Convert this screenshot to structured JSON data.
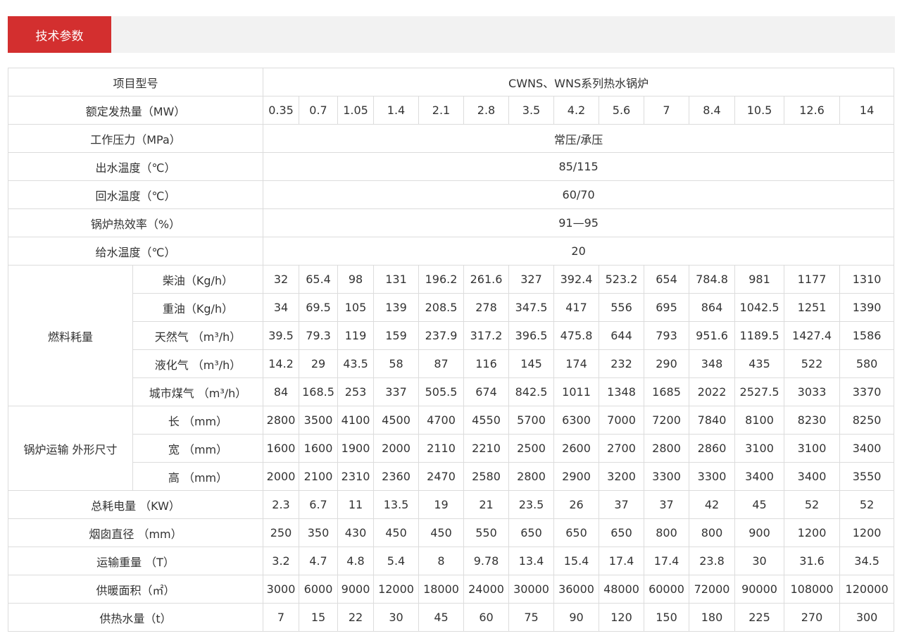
{
  "header": {
    "tab_label": "技术参数"
  },
  "table": {
    "model_label": "项目型号",
    "series_name": "CWNS、WNS系列热水锅炉",
    "capacity_label": "额定发热量（MW）",
    "capacities": [
      "0.35",
      "0.7",
      "1.05",
      "1.4",
      "2.1",
      "2.8",
      "3.5",
      "4.2",
      "5.6",
      "7",
      "8.4",
      "10.5",
      "12.6",
      "14"
    ],
    "span_rows": [
      {
        "label": "工作压力（MPa）",
        "value": "常压/承压"
      },
      {
        "label": "出水温度（℃）",
        "value": "85/115"
      },
      {
        "label": "回水温度（℃）",
        "value": "60/70"
      },
      {
        "label": "锅炉热效率（%）",
        "value": "91—95"
      },
      {
        "label": "给水温度（℃）",
        "value": "20"
      }
    ],
    "groups": [
      {
        "label": "燃料耗量",
        "rows": [
          {
            "label": "柴油（Kg/h）",
            "values": [
              "32",
              "65.4",
              "98",
              "131",
              "196.2",
              "261.6",
              "327",
              "392.4",
              "523.2",
              "654",
              "784.8",
              "981",
              "1177",
              "1310"
            ]
          },
          {
            "label": "重油（Kg/h）",
            "values": [
              "34",
              "69.5",
              "105",
              "139",
              "208.5",
              "278",
              "347.5",
              "417",
              "556",
              "695",
              "864",
              "1042.5",
              "1251",
              "1390"
            ]
          },
          {
            "label": "天然气 （m³/h）",
            "values": [
              "39.5",
              "79.3",
              "119",
              "159",
              "237.9",
              "317.2",
              "396.5",
              "475.8",
              "644",
              "793",
              "951.6",
              "1189.5",
              "1427.4",
              "1586"
            ]
          },
          {
            "label": "液化气 （m³/h）",
            "values": [
              "14.2",
              "29",
              "43.5",
              "58",
              "87",
              "116",
              "145",
              "174",
              "232",
              "290",
              "348",
              "435",
              "522",
              "580"
            ]
          },
          {
            "label": "城市煤气 （m³/h）",
            "values": [
              "84",
              "168.5",
              "253",
              "337",
              "505.5",
              "674",
              "842.5",
              "1011",
              "1348",
              "1685",
              "2022",
              "2527.5",
              "3033",
              "3370"
            ]
          }
        ]
      },
      {
        "label": "锅炉运输 外形尺寸",
        "rows": [
          {
            "label": "长 （mm）",
            "values": [
              "2800",
              "3500",
              "4100",
              "4500",
              "4700",
              "4550",
              "5700",
              "6300",
              "7000",
              "7200",
              "7840",
              "8100",
              "8230",
              "8250"
            ]
          },
          {
            "label": "宽 （mm）",
            "values": [
              "1600",
              "1600",
              "1900",
              "2000",
              "2110",
              "2210",
              "2500",
              "2600",
              "2700",
              "2800",
              "2860",
              "3100",
              "3100",
              "3400"
            ]
          },
          {
            "label": "高 （mm）",
            "values": [
              "2000",
              "2100",
              "2310",
              "2360",
              "2470",
              "2580",
              "2800",
              "2900",
              "3200",
              "3300",
              "3300",
              "3400",
              "3400",
              "3550"
            ]
          }
        ]
      }
    ],
    "rows": [
      {
        "label": "总耗电量 （KW）",
        "values": [
          "2.3",
          "6.7",
          "11",
          "13.5",
          "19",
          "21",
          "23.5",
          "26",
          "37",
          "37",
          "42",
          "45",
          "52",
          "52"
        ]
      },
      {
        "label": "烟囱直径 （mm）",
        "values": [
          "250",
          "350",
          "430",
          "450",
          "450",
          "550",
          "650",
          "650",
          "650",
          "800",
          "800",
          "900",
          "1200",
          "1200"
        ]
      },
      {
        "label": "运输重量 （T）",
        "values": [
          "3.2",
          "4.7",
          "4.8",
          "5.4",
          "8",
          "9.78",
          "13.4",
          "15.4",
          "17.4",
          "17.4",
          "23.8",
          "30",
          "31.6",
          "34.5"
        ]
      },
      {
        "label": "供暖面积（㎡）",
        "values": [
          "3000",
          "6000",
          "9000",
          "12000",
          "18000",
          "24000",
          "30000",
          "36000",
          "48000",
          "60000",
          "72000",
          "90000",
          "108000",
          "120000"
        ]
      },
      {
        "label": "供热水量（t）",
        "values": [
          "7",
          "15",
          "22",
          "30",
          "45",
          "60",
          "75",
          "90",
          "120",
          "150",
          "180",
          "225",
          "270",
          "300"
        ]
      }
    ]
  }
}
